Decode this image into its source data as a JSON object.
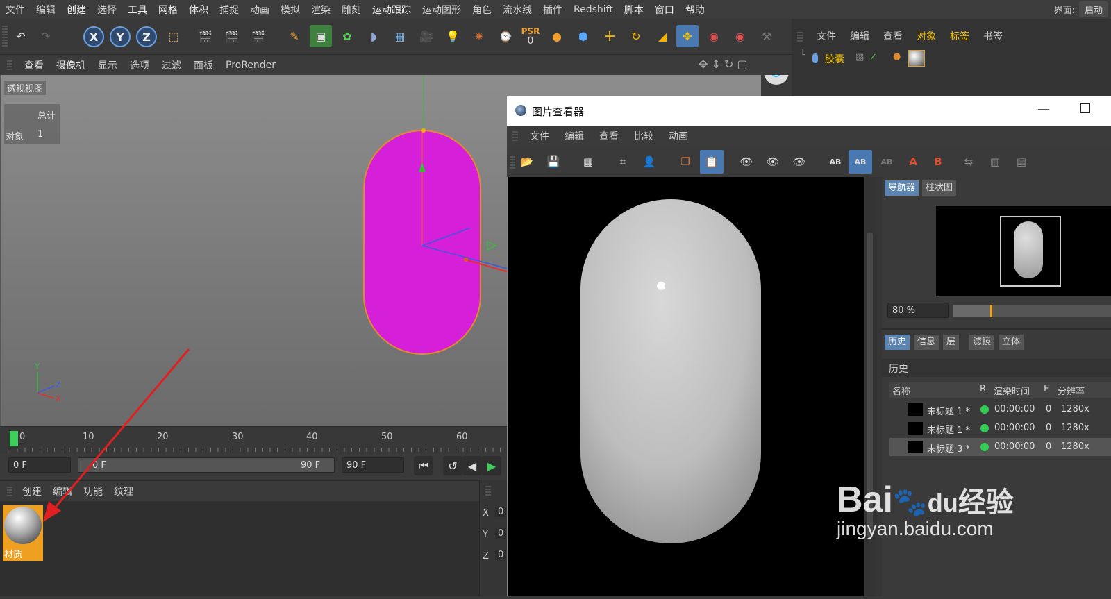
{
  "menubar": {
    "items": [
      "文件",
      "编辑",
      "创建",
      "选择",
      "工具",
      "网格",
      "体积",
      "捕捉",
      "动画",
      "模拟",
      "渲染",
      "雕刻",
      "运动跟踪",
      "运动图形",
      "角色",
      "流水线",
      "插件",
      "Redshift",
      "脚本",
      "窗口",
      "帮助"
    ],
    "layout_label": "界面:",
    "layout_value": "启动"
  },
  "toolbar": {
    "axis_x": "X",
    "axis_y": "Y",
    "axis_z": "Z",
    "psr_label": "PSR",
    "psr_value": "0"
  },
  "viewport_menu": {
    "items": [
      "查看",
      "摄像机",
      "显示",
      "选项",
      "过滤",
      "面板",
      "ProRender"
    ]
  },
  "viewport": {
    "label": "透视视图",
    "stats_header": "总计",
    "stats_label": "对象",
    "stats_value": "1"
  },
  "object_manager": {
    "menu": [
      "文件",
      "编辑",
      "查看",
      "对象",
      "标签",
      "书签"
    ],
    "object_name": "胶囊"
  },
  "timeline": {
    "ticks": [
      "0",
      "10",
      "20",
      "30",
      "40",
      "50",
      "60"
    ],
    "current_frame": "0 F",
    "range_start": "0 F",
    "range_end": "90 F",
    "end_frame": "90 F"
  },
  "material_manager": {
    "menu": [
      "创建",
      "编辑",
      "功能",
      "纹理"
    ],
    "material_name": "材质"
  },
  "coords": {
    "x": "0",
    "y": "0",
    "z": "0",
    "x_label": "X",
    "y_label": "Y",
    "z_label": "Z"
  },
  "picture_viewer": {
    "title": "图片查看器",
    "menu": [
      "文件",
      "编辑",
      "查看",
      "比较",
      "动画"
    ],
    "tabs_top": [
      "导航器",
      "柱状图"
    ],
    "zoom": "80 %",
    "tabs_mid": [
      "历史",
      "信息",
      "层",
      "滤镜",
      "立体"
    ],
    "history_title": "历史",
    "history_columns": [
      "名称",
      "R",
      "渲染时间",
      "F",
      "分辨率"
    ],
    "history_rows": [
      {
        "name": "未标题 1 *",
        "time": "00:00:00",
        "f": "0",
        "res": "1280x"
      },
      {
        "name": "未标题 1 *",
        "time": "00:00:00",
        "f": "0",
        "res": "1280x"
      },
      {
        "name": "未标题 3 *",
        "time": "00:00:00",
        "f": "0",
        "res": "1280x"
      }
    ]
  },
  "watermark": {
    "brand": "Bai",
    "brand2": "du",
    "suffix": "经验",
    "url": "jingyan.baidu.com"
  },
  "colors": {
    "capsule_viewport": "#d61fd8",
    "capsule_outline": "#e08a30",
    "accent_blue": "#5b84b0",
    "arrow_red": "#e02020"
  }
}
